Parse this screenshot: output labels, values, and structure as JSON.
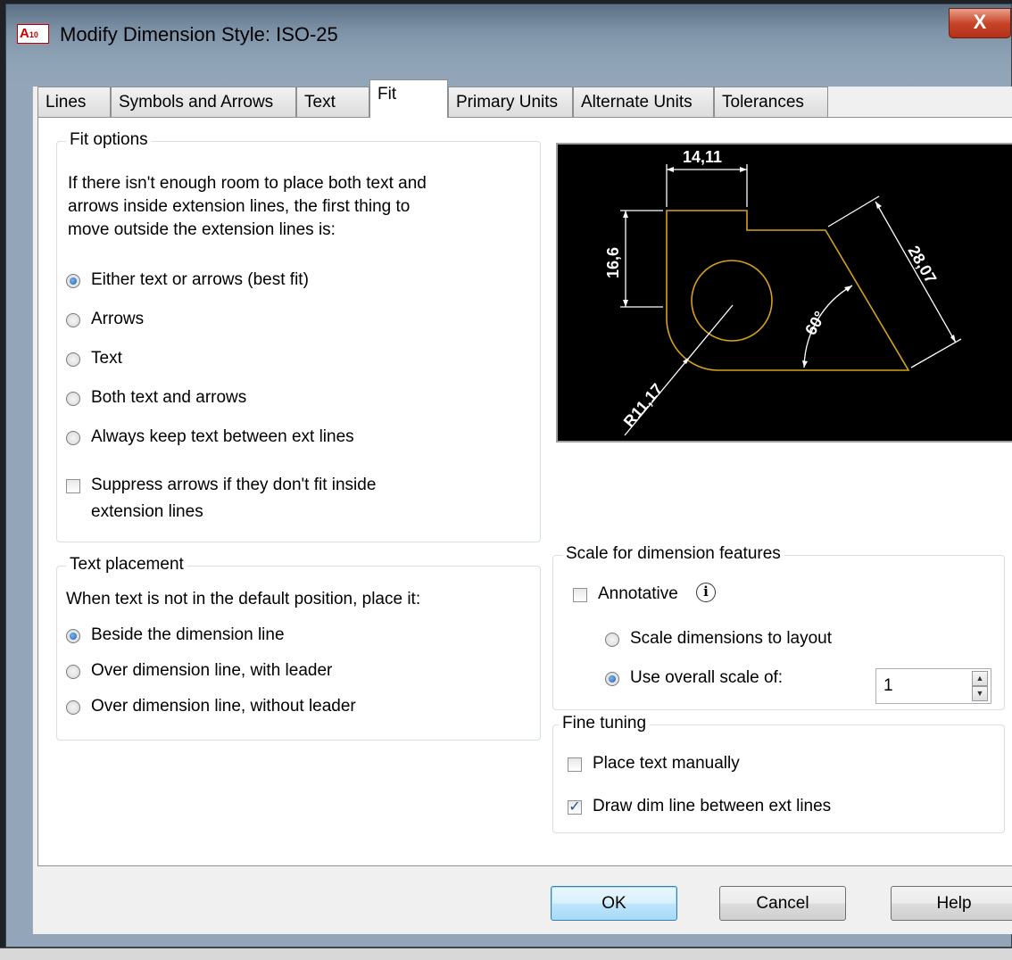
{
  "window": {
    "app_icon": "A",
    "app_icon_sub": "10",
    "title": "Modify Dimension Style: ISO-25",
    "close_label": "X"
  },
  "tabs": [
    {
      "label": "Lines"
    },
    {
      "label": "Symbols and Arrows"
    },
    {
      "label": "Text"
    },
    {
      "label": "Fit",
      "selected": true
    },
    {
      "label": "Primary Units"
    },
    {
      "label": "Alternate Units"
    },
    {
      "label": "Tolerances"
    }
  ],
  "fit_options": {
    "legend": "Fit options",
    "description": [
      "If there isn't enough room to place both text and",
      "arrows inside extension lines, the first thing to",
      "move outside the extension lines is:"
    ],
    "options": [
      {
        "label": "Either text or arrows (best fit)",
        "selected": true
      },
      {
        "label": "Arrows",
        "selected": false
      },
      {
        "label": "Text",
        "selected": false
      },
      {
        "label": "Both text and arrows",
        "selected": false
      },
      {
        "label": "Always keep text between ext lines",
        "selected": false
      }
    ],
    "suppress": {
      "line1": "Suppress arrows if they don't fit inside",
      "line2": "extension lines",
      "checked": false
    }
  },
  "text_placement": {
    "legend": "Text placement",
    "description": "When text is not in the default position, place it:",
    "options": [
      {
        "label": "Beside the dimension line",
        "selected": true
      },
      {
        "label": "Over dimension line, with leader",
        "selected": false
      },
      {
        "label": "Over dimension line, without leader",
        "selected": false
      }
    ]
  },
  "preview": {
    "dims": {
      "top": "14,11",
      "left": "16,6",
      "diagonal": "28,07",
      "angle": "60°",
      "radius": "R11,17"
    },
    "colors": {
      "geometry": "#d6a21c",
      "dimension": "#ffffff",
      "background": "#000000"
    }
  },
  "scale": {
    "legend": "Scale for dimension features",
    "annotative": {
      "label": "Annotative",
      "checked": false
    },
    "info_icon": "i",
    "options": [
      {
        "label": "Scale dimensions to layout",
        "selected": false
      },
      {
        "label": "Use overall scale of:",
        "selected": true
      }
    ],
    "overall_value": "1"
  },
  "fine_tuning": {
    "legend": "Fine tuning",
    "place_manually": {
      "label": "Place text manually",
      "checked": false
    },
    "draw_dim_line": {
      "label": "Draw dim line between ext lines",
      "checked": true
    }
  },
  "buttons": {
    "ok": "OK",
    "cancel": "Cancel",
    "help": "Help"
  },
  "icons": {
    "check_mark": "✓",
    "spin_up": "▲",
    "spin_down": "▼"
  }
}
